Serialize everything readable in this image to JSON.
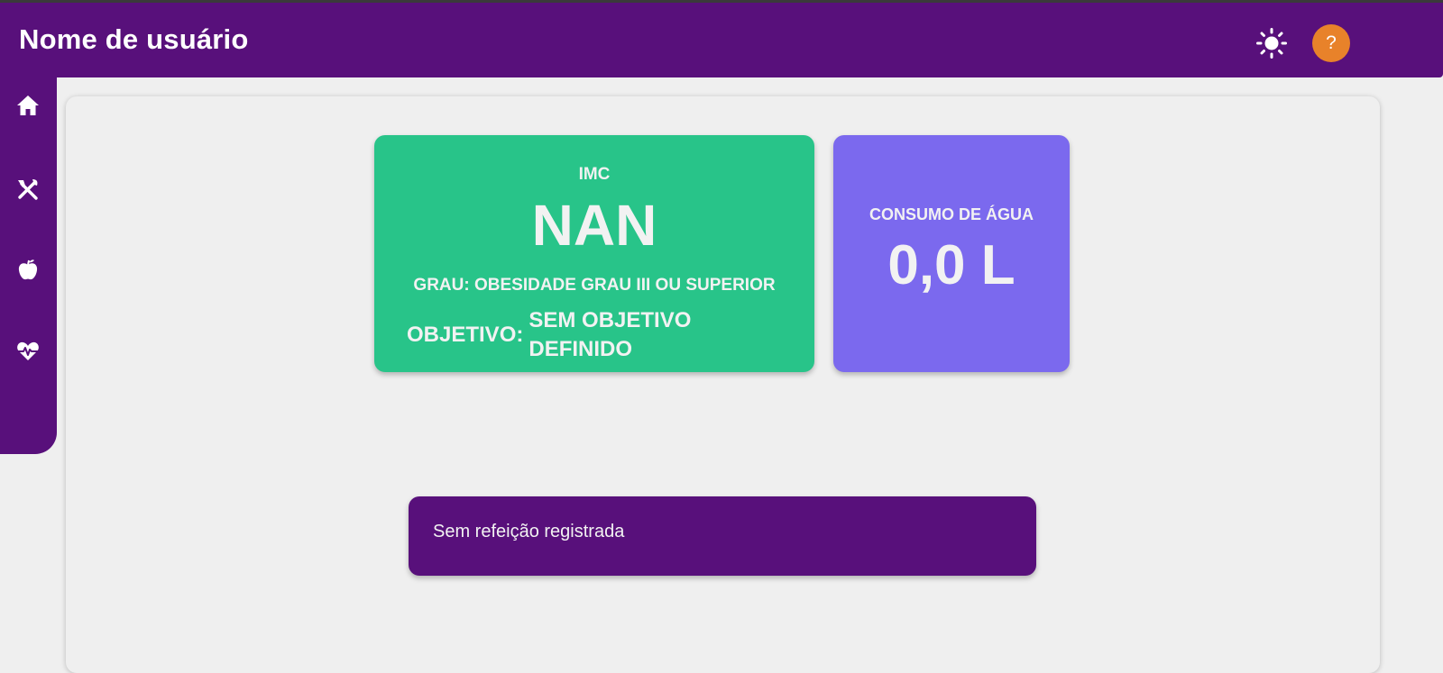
{
  "header": {
    "title": "Nome de usuário",
    "theme_icon": "sun-icon",
    "help_label": "?"
  },
  "sidebar": {
    "items": [
      {
        "icon": "home-icon"
      },
      {
        "icon": "utensils-icon"
      },
      {
        "icon": "apple-icon"
      },
      {
        "icon": "heart-pulse-icon"
      }
    ]
  },
  "imc_card": {
    "label": "IMC",
    "value": "NAN",
    "grade": "GRAU: OBESIDADE GRAU III OU SUPERIOR",
    "objective_label": "OBJETIVO:",
    "objective_value": "SEM OBJETIVO DEFINIDO",
    "color": "#28c489"
  },
  "water_card": {
    "label": "CONSUMO DE ÁGUA",
    "value": "0,0 L",
    "color": "#7b69ee"
  },
  "meals": {
    "empty_text": "Sem refeição registrada"
  },
  "colors": {
    "primary": "#58107b",
    "accent": "#e8822a"
  }
}
